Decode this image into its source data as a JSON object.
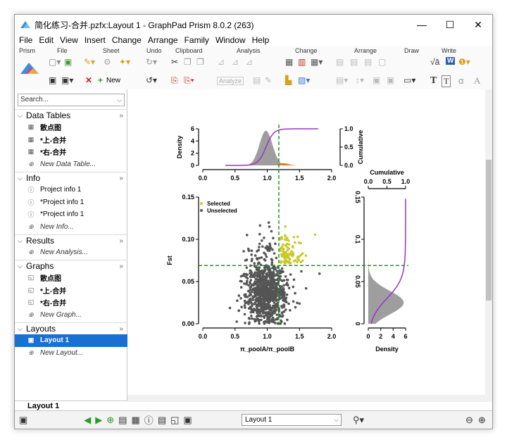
{
  "window": {
    "title": "简化练习-合并.pzfx:Layout 1 - GraphPad Prism 8.0.2 (263)",
    "minimize": "—",
    "maximize": "☐",
    "close": "✕"
  },
  "menu": [
    "File",
    "Edit",
    "View",
    "Insert",
    "Change",
    "Arrange",
    "Family",
    "Window",
    "Help"
  ],
  "ribbon": {
    "groups": [
      "Prism",
      "File",
      "Sheet",
      "Undo",
      "Clipboard",
      "Analysis",
      "Change",
      "Arrange",
      "Draw",
      "Write"
    ],
    "new_label": "New",
    "analyze_label": "Analyze"
  },
  "sidebar": {
    "search_placeholder": "Search...",
    "sections": {
      "data_tables": {
        "label": "Data Tables",
        "items": [
          "散点图",
          "*上-合并",
          "*右-合并"
        ],
        "new": "New Data Table..."
      },
      "info": {
        "label": "Info",
        "items": [
          "Project info 1",
          "*Project info 1",
          "*Project info 1"
        ],
        "new": "New Info..."
      },
      "results": {
        "label": "Results",
        "new": "New Analysis..."
      },
      "graphs": {
        "label": "Graphs",
        "items": [
          "散点图",
          "*上-合并",
          "*右-合并"
        ],
        "new": "New Graph..."
      },
      "layouts": {
        "label": "Layouts",
        "items": [
          "Layout 1"
        ],
        "new": "New Layout..."
      }
    },
    "bottom_sheet": "Layout 1"
  },
  "statusbar": {
    "layout_select": "Layout 1"
  },
  "colors": {
    "selected_blue": "#1a6fd2",
    "unselected_points": "#555555",
    "selected_points": "#c9c92a",
    "threshold_line": "#1a9a1a",
    "cumulative_line": "#9933cc",
    "density_fill": "#9e9e9e",
    "orange_density": "#e07b20"
  },
  "chart_data": {
    "type": "scatter",
    "xlabel": "π_poolA/π_poolB",
    "ylabel": "Fst",
    "xlim": [
      0.0,
      2.0
    ],
    "ylim": [
      0.0,
      0.15
    ],
    "xticks": [
      "0.0",
      "0.5",
      "1.0",
      "1.5",
      "2.0"
    ],
    "yticks": [
      "0.00",
      "0.05",
      "0.10",
      "0.15"
    ],
    "legend": [
      "Selected",
      "Unselected"
    ],
    "thresholds": {
      "x": 1.18,
      "y": 0.069
    },
    "top_marginal": {
      "ylabel_left": "Density",
      "ylabel_right": "Cumulative",
      "left_ticks": [
        "0",
        "2",
        "4",
        "6"
      ],
      "right_ticks": [
        "0.0",
        "0.5",
        "1.0"
      ],
      "xticks": [
        "0.0",
        "0.5",
        "1.0",
        "1.5",
        "2.0"
      ]
    },
    "right_marginal": {
      "top_label": "Cumulative",
      "top_ticks": [
        "0.0",
        "0.5",
        "1.0"
      ],
      "xlabel": "Density",
      "xticks": [
        "0",
        "2",
        "4",
        "6"
      ],
      "yticks": [
        "0",
        "0.05",
        "0.1",
        "0.15"
      ]
    }
  }
}
